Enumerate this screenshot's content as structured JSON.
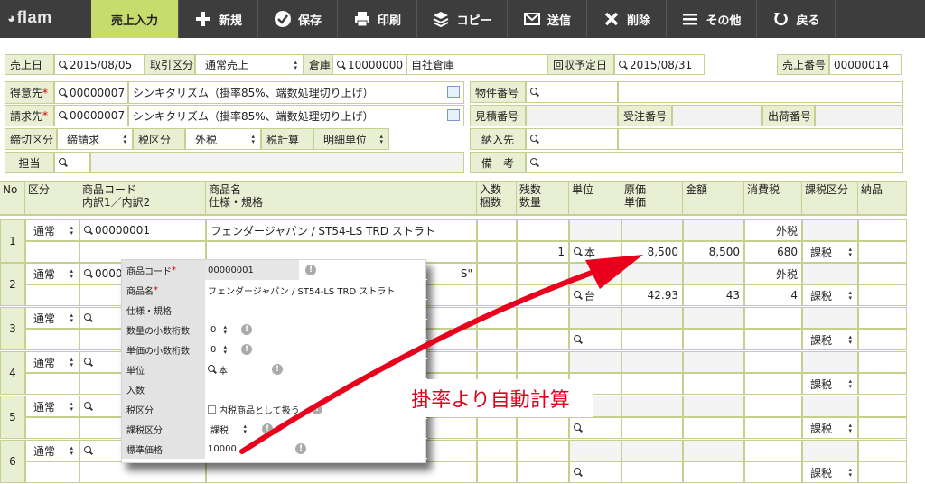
{
  "app": {
    "logo": "flam"
  },
  "toolbar": {
    "items": [
      {
        "label": "売上入力"
      },
      {
        "label": "新規"
      },
      {
        "label": "保存"
      },
      {
        "label": "印刷"
      },
      {
        "label": "コピー"
      },
      {
        "label": "送信"
      },
      {
        "label": "削除"
      },
      {
        "label": "その他"
      },
      {
        "label": "戻る"
      }
    ]
  },
  "header": {
    "sale_date_label": "売上日",
    "sale_date": "2015/08/05",
    "trade_type_label": "取引区分",
    "trade_type": "通常売上",
    "warehouse_label": "倉庫",
    "warehouse_code": "10000000",
    "warehouse_name": "自社倉庫",
    "collect_date_label": "回収予定日",
    "collect_date": "2015/08/31",
    "sale_no_label": "売上番号",
    "sale_no": "00000014",
    "customer_label": "得意先",
    "customer_code": "00000007",
    "customer_name": "シンキタリズム（掛率85%、端数処理切り上げ）",
    "billing_label": "請求先",
    "billing_code": "00000007",
    "billing_name": "シンキタリズム（掛率85%、端数処理切り上げ）",
    "close_label": "締切区分",
    "close_value": "締請求",
    "tax_label": "税区分",
    "tax_value": "外税",
    "taxcalc_label": "税計算",
    "taxcalc_value": "明細単位",
    "staff_label": "担当",
    "property_label": "物件番号",
    "estimate_label": "見積番号",
    "order_label": "受注番号",
    "ship_label": "出荷番号",
    "delivery_label": "納入先",
    "remarks_label": "備　考"
  },
  "grid": {
    "headers": {
      "no": "No",
      "kubun": "区分",
      "code": "商品コード",
      "code2": "内訳1／内訳2",
      "name": "商品名",
      "name2": "仕様・規格",
      "qty_in": "入数",
      "qty_in2": "梱数",
      "zan": "残数",
      "zan2": "数量",
      "unit": "単位",
      "cost": "原価",
      "cost2": "単価",
      "amount": "金額",
      "tax": "消費税",
      "taxkubun": "課税区分",
      "nohin": "納品"
    },
    "rows": [
      {
        "no": "1",
        "kubun": "通常",
        "code": "00000001",
        "name": "フェンダージャパン / ST54-LS TRD ストラト",
        "tax_type": "外税",
        "qty": "1",
        "unit": "本",
        "price": "8,500",
        "amount": "8,500",
        "tax": "680",
        "taxkubun": "課税"
      },
      {
        "no": "2",
        "kubun": "通常",
        "code": "0000",
        "name_tail": "S\"",
        "tax_type": "外税",
        "unit": "台",
        "price": "42.93",
        "amount": "43",
        "tax": "4",
        "taxkubun": "課税"
      },
      {
        "no": "3",
        "kubun": "通常",
        "taxkubun": "課税"
      },
      {
        "no": "4",
        "kubun": "通常",
        "taxkubun": "課税"
      },
      {
        "no": "5",
        "kubun": "通常",
        "taxkubun": "課税"
      },
      {
        "no": "6",
        "kubun": "通常",
        "taxkubun": "課税"
      }
    ]
  },
  "popup": {
    "code_label": "商品コード",
    "code": "00000001",
    "name_label": "商品名",
    "name": "フェンダージャパン / ST54-LS TRD ストラト",
    "spec_label": "仕様・規格",
    "qty_dec_label": "数量の小数桁数",
    "qty_dec": "0",
    "price_dec_label": "単価の小数桁数",
    "price_dec": "0",
    "unit_label": "単位",
    "unit": "本",
    "irisu_label": "入数",
    "taxkubun_label": "税区分",
    "taxkubun_check": "内税商品として扱う",
    "kazei_label": "課税区分",
    "kazei": "課税",
    "std_price_label": "標準価格",
    "std_price": "10000"
  },
  "annotation": {
    "text": "掛率より自動計算",
    "color": "#e0001a"
  },
  "colors": {
    "accent": "#c8dc6e",
    "toolbar": "#3d3d3d",
    "label_bg": "#e9efd2",
    "border": "#c5d08f"
  }
}
